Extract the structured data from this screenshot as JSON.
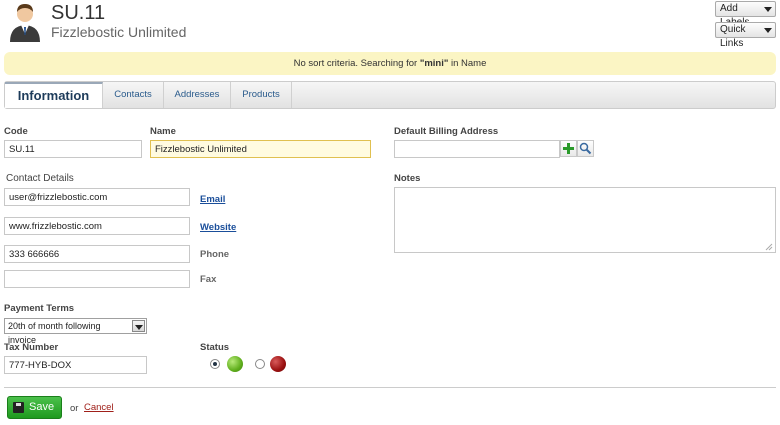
{
  "header": {
    "title": "SU.11",
    "subtitle": "Fizzlebostic Unlimited",
    "add_labels": "Add Labels",
    "quick_links": "Quick Links"
  },
  "notice": {
    "prefix": "No sort criteria. Searching for ",
    "term": "\"mini\"",
    "suffix": " in Name"
  },
  "tabs": [
    {
      "label": "Information",
      "active": true
    },
    {
      "label": "Contacts"
    },
    {
      "label": "Addresses"
    },
    {
      "label": "Products"
    }
  ],
  "form": {
    "code_label": "Code",
    "code_value": "SU.11",
    "name_label": "Name",
    "name_value": "Fizzlebostic Unlimited",
    "billing_label": "Default Billing Address",
    "billing_value": "",
    "contact_details_label": "Contact Details",
    "email_value": "user@frizzlebostic.com",
    "email_link": "Email",
    "website_value": "www.frizzlebostic.com",
    "website_link": "Website",
    "phone_value": "333 666666",
    "phone_label": "Phone",
    "fax_value": "",
    "fax_label": "Fax",
    "notes_label": "Notes",
    "notes_value": "",
    "payment_terms_label": "Payment Terms",
    "payment_terms_value": "20th of month following invoice",
    "tax_number_label": "Tax Number",
    "tax_number_value": "777-HYB-DOX",
    "status_label": "Status",
    "status_selected": "green"
  },
  "actions": {
    "save_label": "Save",
    "or_text": "or",
    "cancel_label": "Cancel"
  },
  "colors": {
    "accent_link": "#1a4e9a",
    "save_green": "#2aa52a",
    "notice_bg": "#fbf5c4",
    "cancel_red": "#a0201a"
  }
}
